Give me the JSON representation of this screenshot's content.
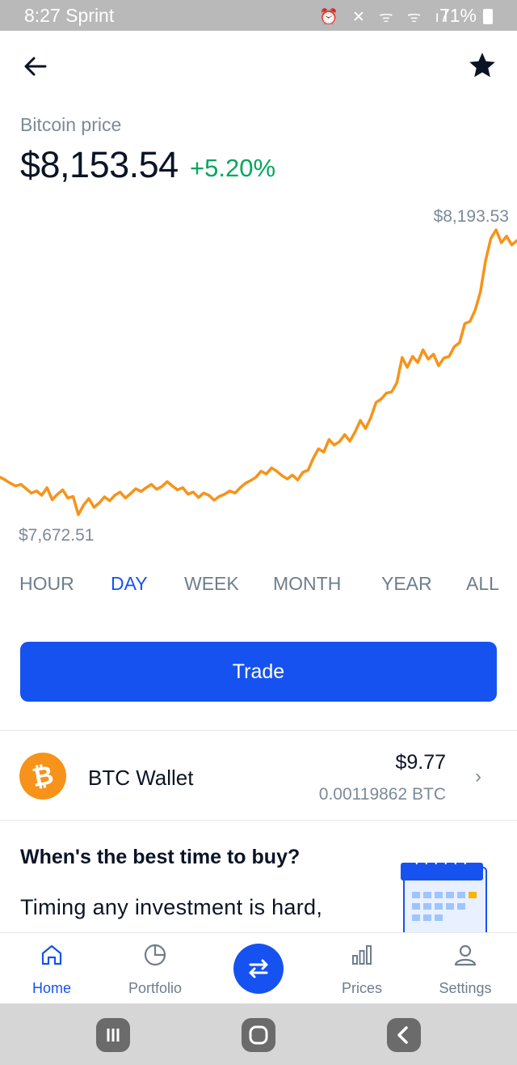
{
  "status_bar": {
    "time_carrier": "8:27 Sprint",
    "system_icons": "⏰ ✕ ᯤ ᯤ ıl",
    "battery": "71%"
  },
  "header": {
    "back_icon": "arrow-left-icon",
    "favorite_icon": "star-icon"
  },
  "asset": {
    "label": "Bitcoin price",
    "price": "$8,153.54",
    "change": "+5.20%",
    "change_color": "#05a65d"
  },
  "chart_data": {
    "type": "line",
    "high_label": "$8,193.53",
    "low_label": "$7,672.51",
    "ylim": [
      7672.51,
      8193.53
    ],
    "line_color": "#f7931a",
    "series": [
      {
        "values": [
          7741,
          7736,
          7730,
          7725,
          7728,
          7720,
          7712,
          7716,
          7708,
          7722,
          7700,
          7710,
          7718,
          7703,
          7706,
          7672.51,
          7690,
          7702,
          7686,
          7694,
          7705,
          7698,
          7708,
          7714,
          7703,
          7711,
          7720,
          7715,
          7722,
          7728,
          7719,
          7724,
          7733,
          7725,
          7718,
          7722,
          7710,
          7714,
          7704,
          7712,
          7708,
          7699,
          7706,
          7710,
          7716,
          7712,
          7722,
          7730,
          7735,
          7741,
          7752,
          7747,
          7758,
          7752,
          7744,
          7738,
          7745,
          7736,
          7750,
          7754,
          7776,
          7793,
          7787,
          7810,
          7800,
          7806,
          7819,
          7807,
          7824,
          7845,
          7830,
          7850,
          7878,
          7884,
          7895,
          7897,
          7914,
          7960,
          7942,
          7962,
          7951,
          7974,
          7957,
          7966,
          7945,
          7959,
          7962,
          7980,
          7987,
          8022,
          8026,
          8047,
          8080,
          8138,
          8178,
          8193.53,
          8170,
          8182,
          8166,
          8174
        ]
      }
    ]
  },
  "ranges": {
    "tabs": [
      "HOUR",
      "DAY",
      "WEEK",
      "MONTH",
      "YEAR",
      "ALL"
    ],
    "active": "DAY"
  },
  "trade_button": {
    "label": "Trade"
  },
  "wallet": {
    "icon": "bitcoin-icon",
    "symbol": "₿",
    "name": "BTC Wallet",
    "fiat_balance": "$9.77",
    "crypto_balance": "0.00119862 BTC"
  },
  "article": {
    "title": "When's the best time to buy?",
    "body": "Timing any investment is hard,",
    "image": "calendar-illustration"
  },
  "bottom_nav": {
    "items": [
      {
        "label": "Home",
        "icon": "home-icon",
        "active": true
      },
      {
        "label": "Portfolio",
        "icon": "pie-chart-icon",
        "active": false
      },
      {
        "label": "",
        "icon": "swap-arrows-icon",
        "active": false
      },
      {
        "label": "Prices",
        "icon": "bar-chart-icon",
        "active": false
      },
      {
        "label": "Settings",
        "icon": "user-icon",
        "active": false
      }
    ],
    "accent_color": "#1652f0"
  },
  "android_nav": {
    "buttons": [
      "recent-apps-icon",
      "home-circle-icon",
      "back-chevron-icon"
    ]
  }
}
